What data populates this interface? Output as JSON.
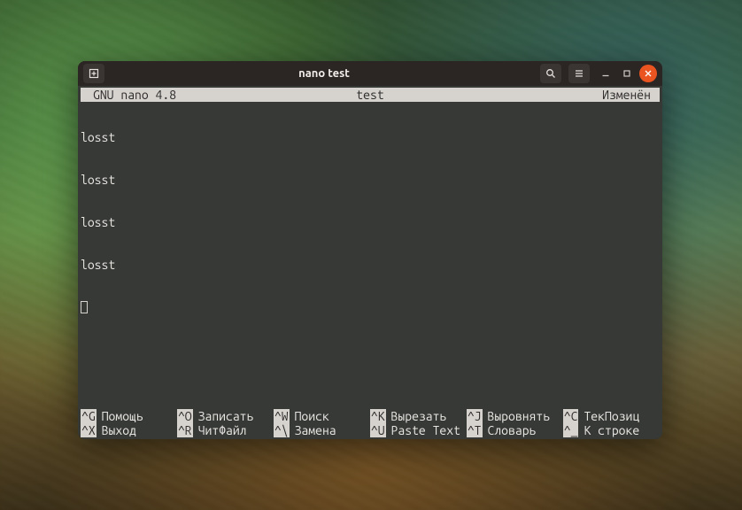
{
  "window": {
    "title": "nano test"
  },
  "nano": {
    "header_left": "GNU nano 4.8",
    "header_filename": "test",
    "header_status": "Изменён",
    "lines": [
      "losst",
      "losst",
      "losst",
      "losst"
    ],
    "shortcuts_row1": [
      {
        "key": "^G",
        "label": "Помощь"
      },
      {
        "key": "^O",
        "label": "Записать"
      },
      {
        "key": "^W",
        "label": "Поиск"
      },
      {
        "key": "^K",
        "label": "Вырезать"
      },
      {
        "key": "^J",
        "label": "Выровнять"
      },
      {
        "key": "^C",
        "label": "ТекПозиц"
      }
    ],
    "shortcuts_row2": [
      {
        "key": "^X",
        "label": "Выход"
      },
      {
        "key": "^R",
        "label": "ЧитФайл"
      },
      {
        "key": "^\\",
        "label": "Замена"
      },
      {
        "key": "^U",
        "label": "Paste Text"
      },
      {
        "key": "^T",
        "label": "Словарь"
      },
      {
        "key": "^_",
        "label": "К строке"
      }
    ]
  }
}
